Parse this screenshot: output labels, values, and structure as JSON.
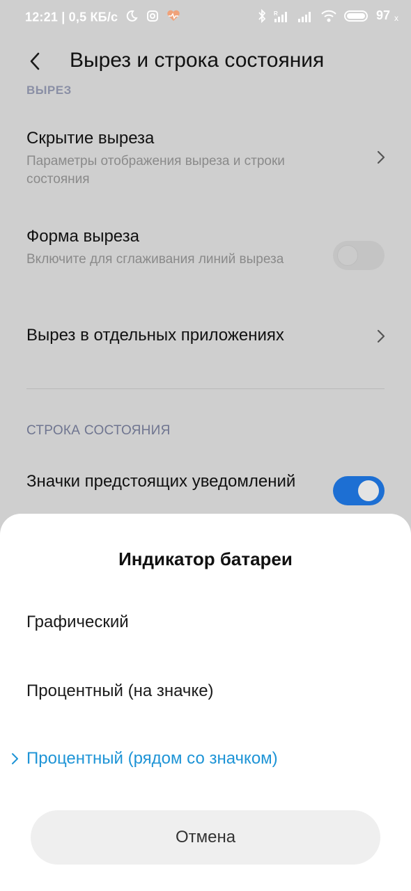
{
  "status_bar": {
    "time_speed": "12:21 | 0,5 КБ/с",
    "battery": "97",
    "battery_suffix": "x"
  },
  "header": {
    "title": "Вырез и строка состояния"
  },
  "section_cut": {
    "label": "ВЫРЕЗ"
  },
  "settings": {
    "hide_cutout": {
      "title": "Скрытие выреза",
      "subtitle": "Параметры отображения выреза и строки состояния"
    },
    "cutout_shape": {
      "title": "Форма выреза",
      "subtitle": "Включите для сглаживания линий выреза",
      "enabled": false
    },
    "per_app": {
      "title": "Вырез в отдельных приложениях"
    }
  },
  "section_status": {
    "label": "СТРОКА СОСТОЯНИЯ"
  },
  "upcoming_notifications": {
    "title": "Значки предстоящих уведомлений",
    "enabled": true
  },
  "sheet": {
    "title": "Индикатор батареи",
    "options": [
      {
        "label": "Графический",
        "selected": false
      },
      {
        "label": "Процентный (на значке)",
        "selected": false
      },
      {
        "label": "Процентный (рядом со значком)",
        "selected": true
      }
    ],
    "cancel_label": "Отмена"
  },
  "colors": {
    "accent": "#1e94d6",
    "toggle_on": "#1d6fd3",
    "dim_background": "#cfcfcf"
  }
}
